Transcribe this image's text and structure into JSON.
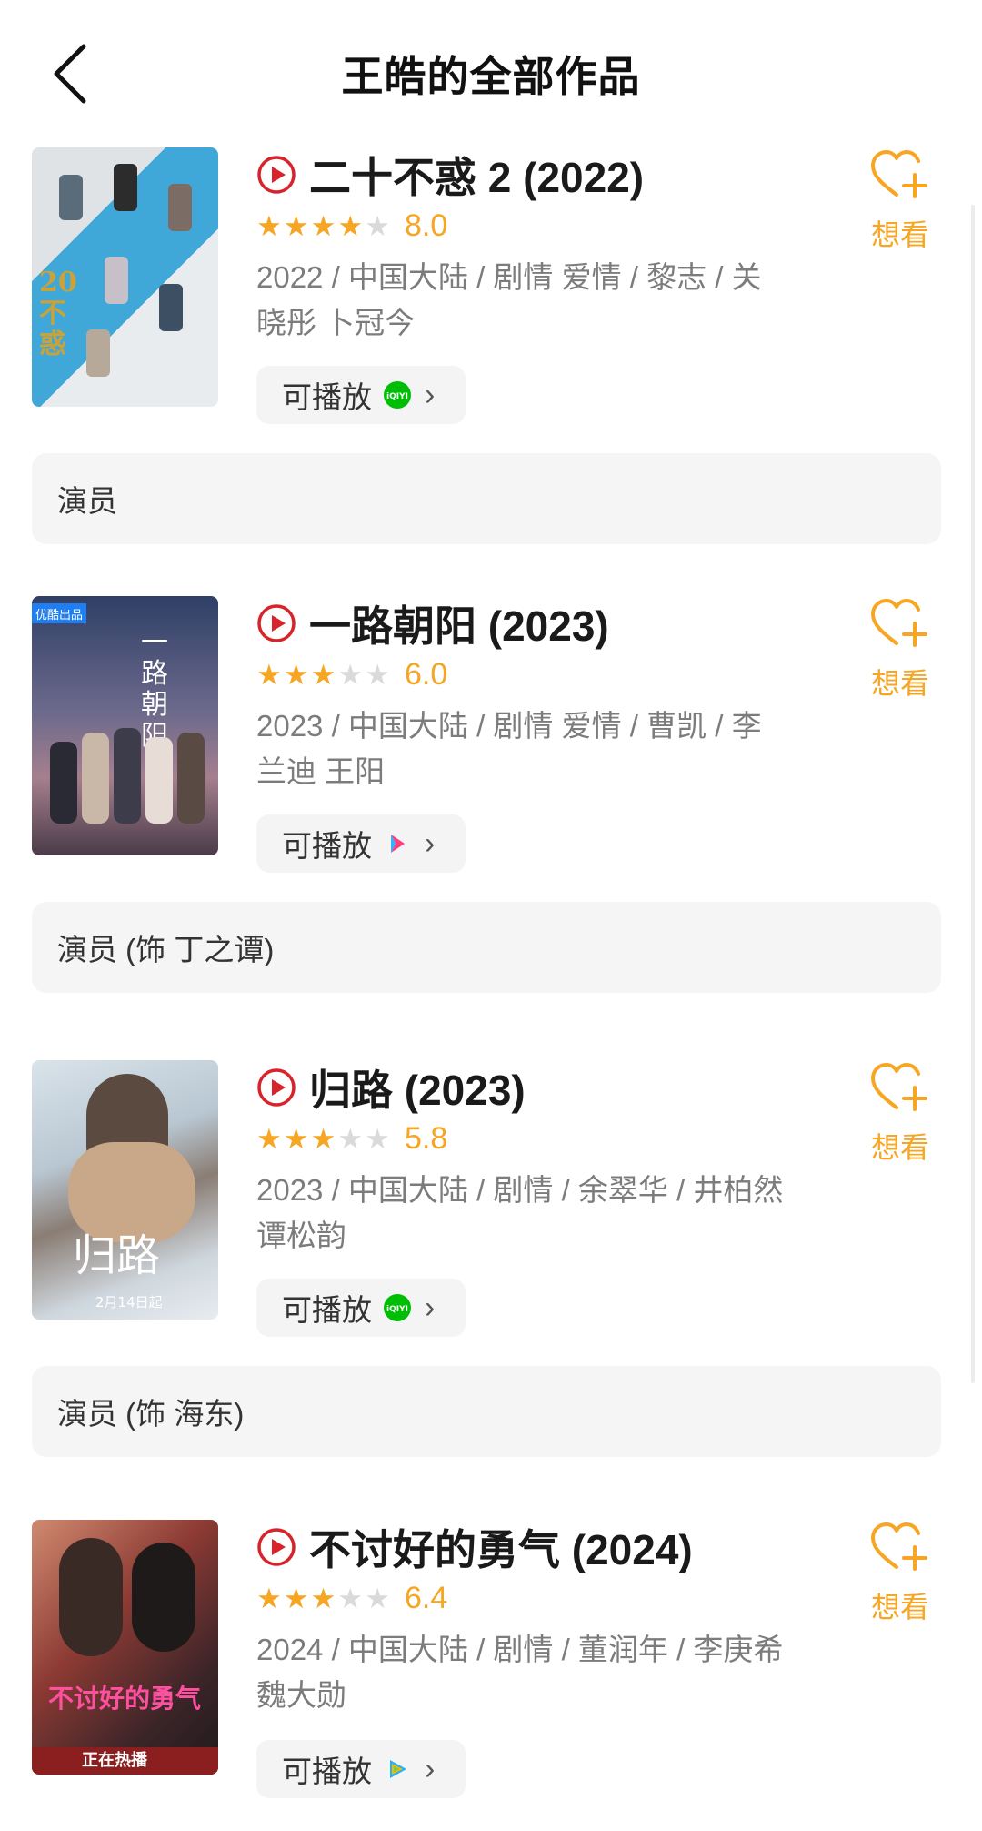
{
  "header": {
    "title": "王皓的全部作品",
    "back_icon": "chevron-left-icon"
  },
  "colors": {
    "accent": "#f6a623",
    "play_red": "#d8232a",
    "meta_gray": "#7c7c7c",
    "chip_bg": "#f4f4f4"
  },
  "works": [
    {
      "title": "二十不惑 2 (2022)",
      "stars_filled": 4,
      "stars_total": 5,
      "rating": "8.0",
      "meta": "2022 / 中国大陆 / 剧情 爱情 / 黎志 / 关晓彤 卜冠今",
      "play_label": "可播放",
      "platform": "iqiyi",
      "platform_text": "iQIYI",
      "want_label": "想看",
      "role": "演员",
      "poster_text": "20不惑"
    },
    {
      "title": "一路朝阳 (2023)",
      "stars_filled": 3,
      "stars_total": 5,
      "rating": "6.0",
      "meta": "2023 / 中国大陆 / 剧情 爱情 / 曹凯 / 李兰迪 王阳",
      "play_label": "可播放",
      "platform": "youku",
      "platform_text": "",
      "want_label": "想看",
      "role": "演员 (饰 丁之谭)",
      "poster_text": "一路朝阳",
      "poster_badge": "优酷出品"
    },
    {
      "title": "归路 (2023)",
      "stars_filled": 3,
      "stars_total": 5,
      "rating": "5.8",
      "meta": "2023 / 中国大陆 / 剧情 / 余翠华 / 井柏然 谭松韵",
      "play_label": "可播放",
      "platform": "iqiyi",
      "platform_text": "iQIYI",
      "want_label": "想看",
      "role": "演员 (饰 海东)",
      "poster_text": "归路",
      "poster_badge": "2月14日起"
    },
    {
      "title": "不讨好的勇气 (2024)",
      "stars_filled": 3,
      "stars_total": 5,
      "rating": "6.4",
      "meta": "2024 / 中国大陆 / 剧情 / 董润年 / 李庚希 魏大勋",
      "play_label": "可播放",
      "platform": "tencent",
      "platform_text": "",
      "want_label": "想看",
      "role": "",
      "poster_text": "不讨好的勇气",
      "poster_badge": "正在热播"
    }
  ]
}
